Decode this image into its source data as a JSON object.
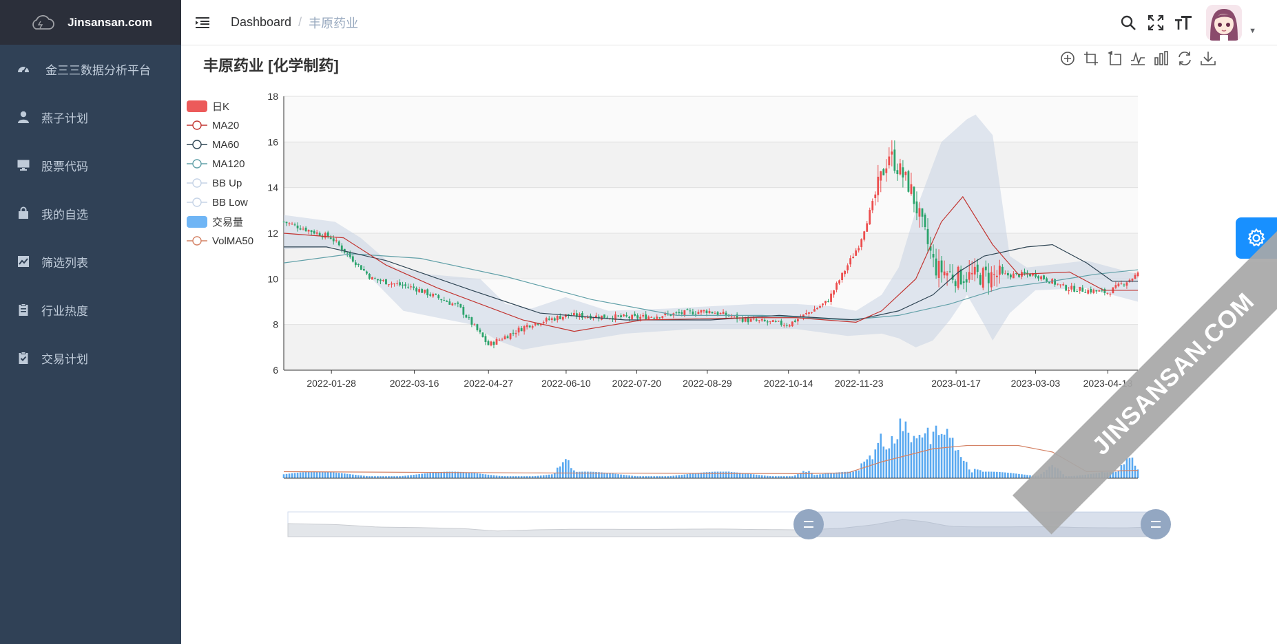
{
  "app": {
    "logo_text": "Jinsansan.com"
  },
  "sidebar": {
    "items": [
      {
        "label": "金三三数据分析平台",
        "icon": "dashboard-icon"
      },
      {
        "label": "燕子计划",
        "icon": "user-icon"
      },
      {
        "label": "股票代码",
        "icon": "monitor-icon"
      },
      {
        "label": "我的自选",
        "icon": "shopping-bag-icon"
      },
      {
        "label": "筛选列表",
        "icon": "chart-icon"
      },
      {
        "label": "行业热度",
        "icon": "clipboard-icon"
      },
      {
        "label": "交易计划",
        "icon": "checklist-icon"
      }
    ]
  },
  "header": {
    "breadcrumb": {
      "home": "Dashboard",
      "separator": "/",
      "current": "丰原药业"
    }
  },
  "chart": {
    "title": "丰原药业 [化学制药]"
  },
  "legend": [
    {
      "label": "日K",
      "color": "#ec5a5a",
      "symbol": "rect"
    },
    {
      "label": "MA20",
      "color": "#c23531",
      "symbol": "circle"
    },
    {
      "label": "MA60",
      "color": "#2f4554",
      "symbol": "circle"
    },
    {
      "label": "MA120",
      "color": "#61a0a8",
      "symbol": "circle"
    },
    {
      "label": "BB Up",
      "color": "#c5d3e6",
      "symbol": "circle"
    },
    {
      "label": "BB Low",
      "color": "#c5d3e6",
      "symbol": "circle"
    },
    {
      "label": "交易量",
      "color": "#6fb5f5",
      "symbol": "rect"
    },
    {
      "label": "VolMA50",
      "color": "#d48265",
      "symbol": "circle"
    }
  ],
  "watermark": "JINSANSAN.COM",
  "colors": {
    "up": "#ec4d4d",
    "down": "#2aa36b",
    "bands": "#c9d4e3",
    "volume": "#5aa9f0",
    "accent": "#1890ff"
  },
  "chart_data": {
    "type": "candlestick",
    "y_range": [
      6,
      18
    ],
    "y_ticks": [
      "6",
      "8",
      "10",
      "12",
      "14",
      "16",
      "18"
    ],
    "x_tick_labels": [
      "2022-01-28",
      "2022-03-16",
      "2022-04-27",
      "2022-06-10",
      "2022-07-20",
      "2022-08-29",
      "2022-10-14",
      "2022-11-23",
      "2023-01-17",
      "2023-03-03",
      "2023-04-13"
    ],
    "anchors": [
      {
        "date": "2022-01-01",
        "close": 12.5
      },
      {
        "date": "2022-01-28",
        "close": 11.8
      },
      {
        "date": "2022-02-20",
        "close": 10.0
      },
      {
        "date": "2022-03-16",
        "close": 9.6
      },
      {
        "date": "2022-04-10",
        "close": 8.8
      },
      {
        "date": "2022-04-27",
        "close": 7.1
      },
      {
        "date": "2022-05-20",
        "close": 8.0
      },
      {
        "date": "2022-06-10",
        "close": 8.4
      },
      {
        "date": "2022-07-20",
        "close": 8.3
      },
      {
        "date": "2022-08-29",
        "close": 8.6
      },
      {
        "date": "2022-09-20",
        "close": 8.2
      },
      {
        "date": "2022-10-14",
        "close": 8.0
      },
      {
        "date": "2022-11-05",
        "close": 9.0
      },
      {
        "date": "2022-11-23",
        "close": 11.5
      },
      {
        "date": "2022-12-10",
        "close": 15.5
      },
      {
        "date": "2022-12-22",
        "close": 14.0
      },
      {
        "date": "2023-01-05",
        "close": 10.5
      },
      {
        "date": "2023-01-17",
        "close": 10.1
      },
      {
        "date": "2023-03-03",
        "close": 10.2
      },
      {
        "date": "2023-03-20",
        "close": 9.6
      },
      {
        "date": "2023-04-13",
        "close": 9.4
      },
      {
        "date": "2023-04-30",
        "close": 10.2
      }
    ],
    "ma20_points": [
      [
        0,
        12.0
      ],
      [
        0.07,
        11.8
      ],
      [
        0.12,
        10.6
      ],
      [
        0.18,
        9.6
      ],
      [
        0.28,
        8.2
      ],
      [
        0.34,
        7.7
      ],
      [
        0.42,
        8.2
      ],
      [
        0.55,
        8.3
      ],
      [
        0.6,
        8.3
      ],
      [
        0.67,
        8.1
      ],
      [
        0.7,
        8.6
      ],
      [
        0.74,
        10.0
      ],
      [
        0.77,
        12.5
      ],
      [
        0.795,
        13.6
      ],
      [
        0.83,
        11.5
      ],
      [
        0.86,
        10.2
      ],
      [
        0.92,
        10.3
      ],
      [
        0.96,
        9.5
      ],
      [
        1.0,
        9.5
      ]
    ],
    "ma60_points": [
      [
        0,
        11.4
      ],
      [
        0.05,
        11.4
      ],
      [
        0.12,
        10.8
      ],
      [
        0.22,
        9.5
      ],
      [
        0.3,
        8.5
      ],
      [
        0.4,
        8.2
      ],
      [
        0.5,
        8.2
      ],
      [
        0.58,
        8.4
      ],
      [
        0.67,
        8.2
      ],
      [
        0.72,
        8.6
      ],
      [
        0.76,
        9.3
      ],
      [
        0.79,
        10.3
      ],
      [
        0.82,
        11.0
      ],
      [
        0.87,
        11.4
      ],
      [
        0.9,
        11.5
      ],
      [
        0.94,
        10.7
      ],
      [
        0.97,
        9.9
      ],
      [
        1.0,
        9.9
      ]
    ],
    "ma120_points": [
      [
        0,
        10.7
      ],
      [
        0.08,
        11.1
      ],
      [
        0.16,
        10.9
      ],
      [
        0.26,
        10.1
      ],
      [
        0.36,
        9.1
      ],
      [
        0.46,
        8.4
      ],
      [
        0.56,
        8.4
      ],
      [
        0.66,
        8.2
      ],
      [
        0.72,
        8.4
      ],
      [
        0.78,
        8.9
      ],
      [
        0.84,
        9.6
      ],
      [
        0.9,
        9.9
      ],
      [
        0.95,
        10.2
      ],
      [
        1.0,
        10.4
      ]
    ],
    "bb_up_points": [
      [
        0,
        12.8
      ],
      [
        0.06,
        12.5
      ],
      [
        0.09,
        11.8
      ],
      [
        0.13,
        10.5
      ],
      [
        0.17,
        10.2
      ],
      [
        0.23,
        10.0
      ],
      [
        0.26,
        8.9
      ],
      [
        0.29,
        8.7
      ],
      [
        0.33,
        9.2
      ],
      [
        0.38,
        8.6
      ],
      [
        0.45,
        8.7
      ],
      [
        0.55,
        8.9
      ],
      [
        0.6,
        8.9
      ],
      [
        0.64,
        8.8
      ],
      [
        0.67,
        8.6
      ],
      [
        0.7,
        9.3
      ],
      [
        0.72,
        10.5
      ],
      [
        0.74,
        13.0
      ],
      [
        0.77,
        16.0
      ],
      [
        0.8,
        17.0
      ],
      [
        0.81,
        17.2
      ],
      [
        0.83,
        16.3
      ],
      [
        0.85,
        11.0
      ],
      [
        0.87,
        10.5
      ],
      [
        0.94,
        10.8
      ],
      [
        1.0,
        10.2
      ]
    ],
    "bb_low_points": [
      [
        0,
        11.3
      ],
      [
        0.06,
        11.4
      ],
      [
        0.09,
        10.5
      ],
      [
        0.14,
        8.6
      ],
      [
        0.18,
        8.3
      ],
      [
        0.22,
        8.0
      ],
      [
        0.25,
        7.3
      ],
      [
        0.28,
        6.9
      ],
      [
        0.31,
        7.1
      ],
      [
        0.35,
        7.3
      ],
      [
        0.4,
        7.6
      ],
      [
        0.48,
        7.8
      ],
      [
        0.55,
        7.8
      ],
      [
        0.6,
        7.8
      ],
      [
        0.64,
        7.6
      ],
      [
        0.66,
        7.5
      ],
      [
        0.7,
        7.6
      ],
      [
        0.72,
        7.4
      ],
      [
        0.74,
        7.0
      ],
      [
        0.76,
        7.3
      ],
      [
        0.78,
        8.2
      ],
      [
        0.8,
        9.3
      ],
      [
        0.82,
        8.0
      ],
      [
        0.83,
        7.3
      ],
      [
        0.85,
        8.5
      ],
      [
        0.88,
        9.5
      ],
      [
        0.94,
        9.6
      ],
      [
        1.0,
        9.0
      ]
    ],
    "volume_peaks": [
      [
        0.03,
        0.12
      ],
      [
        0.33,
        0.3
      ],
      [
        0.52,
        0.12
      ],
      [
        0.61,
        0.12
      ],
      [
        0.67,
        0.12
      ],
      [
        0.685,
        0.35
      ],
      [
        0.7,
        0.7
      ],
      [
        0.72,
        0.9
      ],
      [
        0.73,
        0.95
      ],
      [
        0.75,
        1.0
      ],
      [
        0.765,
        0.9
      ],
      [
        0.78,
        0.85
      ],
      [
        0.79,
        0.4
      ],
      [
        0.81,
        0.15
      ],
      [
        0.9,
        0.2
      ],
      [
        0.96,
        0.1
      ],
      [
        0.99,
        0.35
      ]
    ],
    "volma50_points": [
      [
        0,
        0.1
      ],
      [
        0.3,
        0.08
      ],
      [
        0.6,
        0.07
      ],
      [
        0.66,
        0.08
      ],
      [
        0.7,
        0.25
      ],
      [
        0.76,
        0.45
      ],
      [
        0.8,
        0.5
      ],
      [
        0.86,
        0.5
      ],
      [
        0.9,
        0.4
      ],
      [
        0.94,
        0.1
      ],
      [
        1.0,
        0.12
      ]
    ],
    "data_zoom": {
      "start_fraction": 0.6,
      "end_fraction": 1.0
    }
  }
}
